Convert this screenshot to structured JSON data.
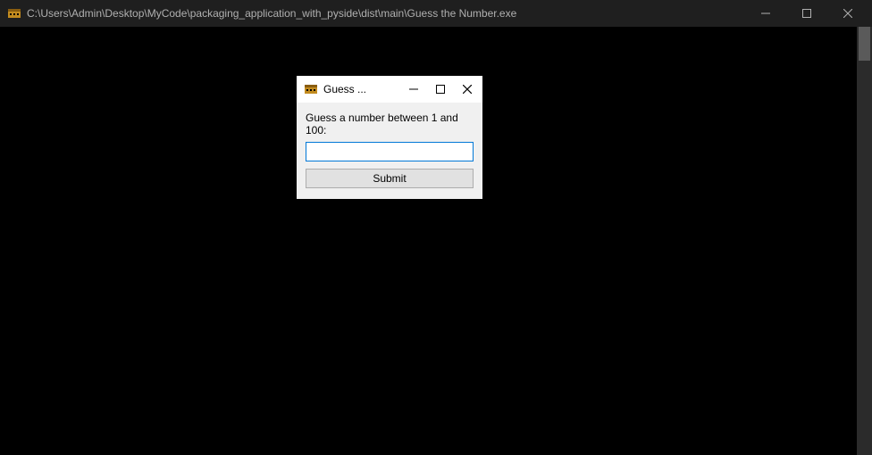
{
  "console": {
    "title": "C:\\Users\\Admin\\Desktop\\MyCode\\packaging_application_with_pyside\\dist\\main\\Guess the Number.exe"
  },
  "dialog": {
    "title": "Guess ...",
    "prompt": "Guess a number between 1 and 100:",
    "input_value": "",
    "submit_label": "Submit"
  }
}
